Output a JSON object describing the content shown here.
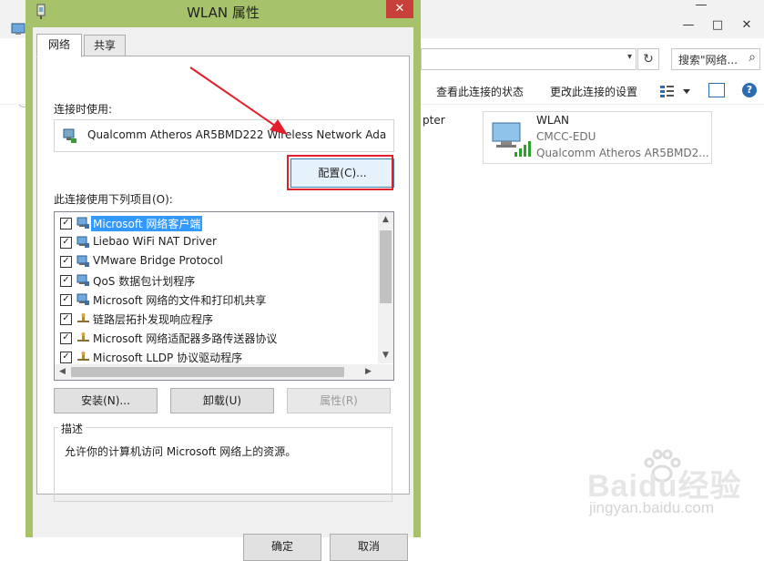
{
  "background_window": {
    "search_placeholder": "搜索\"网络...",
    "toolbar": {
      "view_status": "查看此连接的状态",
      "change_settings": "更改此连接的设置"
    },
    "partial_adapter_text": "pter",
    "wlan_tile": {
      "name": "WLAN",
      "network": "CMCC-EDU",
      "adapter": "Qualcomm Atheros AR5BMD2..."
    }
  },
  "dialog": {
    "title": "WLAN 属性",
    "close_glyph": "✕",
    "tabs": [
      {
        "label": "网络",
        "active": true
      },
      {
        "label": "共享",
        "active": false
      }
    ],
    "connect_using_label": "连接时使用:",
    "adapter_name": "Qualcomm Atheros AR5BMD222 Wireless Network Ada",
    "configure_button": "配置(C)...",
    "items_label": "此连接使用下列项目(O):",
    "items": [
      {
        "label": "Microsoft 网络客户端",
        "checked": true,
        "icon": "network-client-icon",
        "selected": true
      },
      {
        "label": "Liebao WiFi NAT Driver",
        "checked": true,
        "icon": "network-client-icon",
        "selected": false
      },
      {
        "label": "VMware Bridge Protocol",
        "checked": true,
        "icon": "network-client-icon",
        "selected": false
      },
      {
        "label": "QoS 数据包计划程序",
        "checked": true,
        "icon": "network-client-icon",
        "selected": false
      },
      {
        "label": "Microsoft 网络的文件和打印机共享",
        "checked": true,
        "icon": "network-client-icon",
        "selected": false
      },
      {
        "label": "链路层拓扑发现响应程序",
        "checked": true,
        "icon": "protocol-icon",
        "selected": false
      },
      {
        "label": "Microsoft 网络适配器多路传送器协议",
        "checked": true,
        "icon": "protocol-icon",
        "selected": false
      },
      {
        "label": "Microsoft LLDP 协议驱动程序",
        "checked": true,
        "icon": "protocol-icon",
        "selected": false
      }
    ],
    "install_button": "安装(N)...",
    "uninstall_button": "卸载(U)",
    "properties_button": "属性(R)",
    "description_title": "描述",
    "description_text": "允许你的计算机访问 Microsoft 网络上的资源。",
    "ok_button": "确定",
    "cancel_button": "取消"
  },
  "watermark": {
    "brand": "Baidu经验",
    "url": "jingyan.baidu.com"
  },
  "colors": {
    "dialog_frame": "#a6c36c",
    "close_button": "#c7403a",
    "highlight_box": "#e2202c",
    "selection": "#3399ff"
  }
}
